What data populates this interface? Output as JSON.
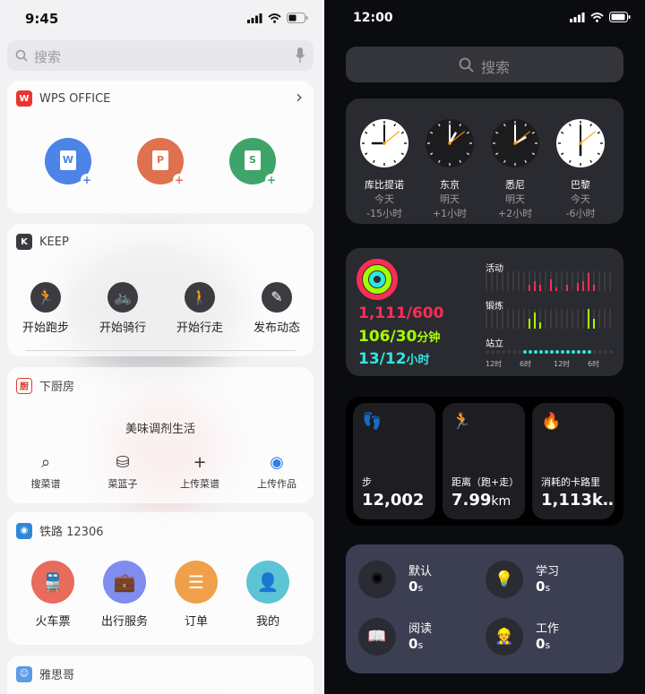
{
  "left": {
    "status_time": "9:45",
    "search_placeholder": "搜索",
    "wps": {
      "title": "WPS OFFICE",
      "icon_letter": "W",
      "chevron": "›",
      "buttons": [
        {
          "letter": "W",
          "color": "#4c84e8",
          "icon": "word-doc-icon"
        },
        {
          "letter": "P",
          "color": "#e0714f",
          "icon": "ppt-doc-icon"
        },
        {
          "letter": "S",
          "color": "#3fa46a",
          "icon": "sheet-doc-icon"
        }
      ]
    },
    "keep": {
      "title": "KEEP",
      "icon_letter": "K",
      "actions": [
        {
          "label": "开始跑步",
          "glyph": "🏃"
        },
        {
          "label": "开始骑行",
          "glyph": "🚲"
        },
        {
          "label": "开始行走",
          "glyph": "🚶"
        },
        {
          "label": "发布动态",
          "glyph": "✎"
        }
      ]
    },
    "xiachufang": {
      "title": "下厨房",
      "icon_letter": "厨",
      "slogan": "美味调剂生活",
      "actions": [
        {
          "label": "搜菜谱",
          "glyph": "⌕",
          "color": "#333333"
        },
        {
          "label": "菜篮子",
          "glyph": "⛁",
          "color": "#333333"
        },
        {
          "label": "上传菜谱",
          "glyph": "+",
          "color": "#333333"
        },
        {
          "label": "上传作品",
          "glyph": "◉",
          "color": "#2f7fe8"
        }
      ]
    },
    "rail": {
      "title": "铁路 12306",
      "actions": [
        {
          "label": "火车票",
          "glyph": "🚆",
          "color": "#e86b5c"
        },
        {
          "label": "出行服务",
          "glyph": "💼",
          "color": "#7f8cf0"
        },
        {
          "label": "订单",
          "glyph": "☰",
          "color": "#f0a04a"
        },
        {
          "label": "我的",
          "glyph": "👤",
          "color": "#5dc4d6"
        }
      ]
    },
    "yasi": {
      "title": "雅思哥"
    }
  },
  "right": {
    "status_time": "12:00",
    "search_placeholder": "搜索",
    "clocks": [
      {
        "city": "库比提诺",
        "day": "今天",
        "offset": "-15小时",
        "hour": 21,
        "minute": 0,
        "theme": "light"
      },
      {
        "city": "东京",
        "day": "明天",
        "offset": "+1小时",
        "hour": 13,
        "minute": 0,
        "theme": "dark"
      },
      {
        "city": "悉尼",
        "day": "明天",
        "offset": "+2小时",
        "hour": 14,
        "minute": 0,
        "theme": "dark"
      },
      {
        "city": "巴黎",
        "day": "今天",
        "offset": "-6小时",
        "hour": 6,
        "minute": 0,
        "theme": "light"
      }
    ],
    "activity": {
      "move": "1,111/600",
      "exercise_value": "106/30",
      "exercise_unit": "分钟",
      "stand_value": "13/12",
      "stand_unit": "小时",
      "labels": {
        "move": "活动",
        "exercise": "锻炼",
        "stand": "站立"
      },
      "time_ticks": [
        "12时",
        "6时",
        "12时",
        "6时"
      ],
      "colors": {
        "move": "#fa2d55",
        "exercise": "#a6ff00",
        "stand": "#2fe6e0"
      }
    },
    "tiles": [
      {
        "label": "步",
        "value": "12,002",
        "unit": "",
        "glyph": "👣",
        "icon": "footprints-icon",
        "color": "#5ac8fa"
      },
      {
        "label": "距离（跑+走）",
        "value": "7.99",
        "unit": "km",
        "glyph": "🏃",
        "icon": "running-icon",
        "color": "#ff9f0a"
      },
      {
        "label": "消耗的卡路里",
        "value": "1,113k…",
        "unit": "",
        "glyph": "🔥",
        "icon": "flame-icon",
        "color": "#ff453a"
      }
    ],
    "focus": [
      {
        "name": "默认",
        "value": "0",
        "unit": "s",
        "glyph": "✺",
        "icon": "default-focus-icon"
      },
      {
        "name": "学习",
        "value": "0",
        "unit": "s",
        "glyph": "💡",
        "icon": "lightbulb-icon"
      },
      {
        "name": "阅读",
        "value": "0",
        "unit": "s",
        "glyph": "📖",
        "icon": "book-icon"
      },
      {
        "name": "工作",
        "value": "0",
        "unit": "s",
        "glyph": "👷",
        "icon": "worker-icon"
      }
    ]
  }
}
